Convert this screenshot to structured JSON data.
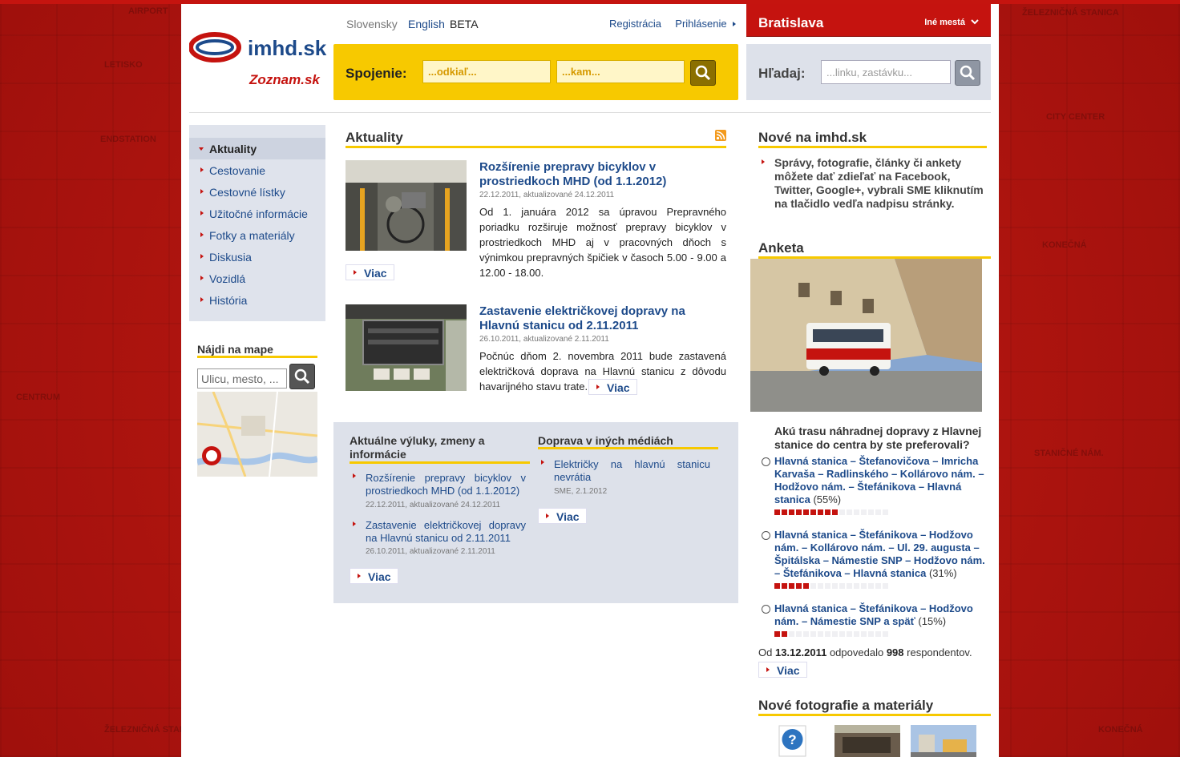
{
  "header": {
    "lang_slovak": "Slovensky",
    "lang_english": "English",
    "beta": "BETA",
    "register": "Registrácia",
    "login": "Prihlásenie",
    "city": "Bratislava",
    "other_cities": "Iné mestá",
    "logo_text": "imhd.sk",
    "logo_partner": "Zoznam.sk"
  },
  "connection": {
    "label": "Spojenie:",
    "from_placeholder": "...odkiaľ...",
    "to_placeholder": "...kam..."
  },
  "search": {
    "label": "Hľadaj:",
    "placeholder": "...linku, zastávku..."
  },
  "nav": {
    "items": [
      {
        "label": "Aktuality",
        "active": true
      },
      {
        "label": "Cestovanie"
      },
      {
        "label": "Cestovné lístky"
      },
      {
        "label": "Užitočné informácie"
      },
      {
        "label": "Fotky a materiály"
      },
      {
        "label": "Diskusia"
      },
      {
        "label": "Vozidlá"
      },
      {
        "label": "História"
      }
    ]
  },
  "map": {
    "title": "Nájdi na mape",
    "placeholder": "Ulicu, mesto, ..."
  },
  "news": {
    "title": "Aktuality",
    "items": [
      {
        "title": "Rozšírenie prepravy bicyklov v prostriedkoch MHD (od 1.1.2012)",
        "date": "22.12.2011, aktualizované 24.12.2011",
        "text": "Od 1. januára 2012 sa úpravou Prepravného poriadku rozširuje možnosť prepravy bicyklov v prostriedkoch MHD aj v pracovných dňoch s výnimkou prepravných špičiek v časoch 5.00 - 9.00 a 12.00 - 18.00.",
        "more": "Viac"
      },
      {
        "title": "Zastavenie električkovej dopravy na Hlavnú stanicu od 2.11.2011",
        "date": "26.10.2011, aktualizované 2.11.2011",
        "text": "Počnúc dňom 2. novembra 2011 bude zastavená električková doprava na Hlavnú stanicu z dôvodu havarijného stavu trate.",
        "more": "Viac"
      }
    ]
  },
  "outages": {
    "title": "Aktuálne výluky, zmeny a informácie",
    "items": [
      {
        "title": "Rozšírenie prepravy bicyklov v prostriedkoch MHD (od 1.1.2012)",
        "date": "22.12.2011, aktualizované 24.12.2011"
      },
      {
        "title": "Zastavenie električkovej dopravy na Hlavnú stanicu od 2.11.2011",
        "date": "26.10.2011, aktualizované 2.11.2011"
      }
    ],
    "more": "Viac"
  },
  "media": {
    "title": "Doprava v iných médiách",
    "items": [
      {
        "title": "Električky na hlavnú stanicu nevrátia",
        "date": "SME, 2.1.2012"
      }
    ],
    "more": "Viac"
  },
  "new_on_site": {
    "title": "Nové na imhd.sk",
    "text": "Správy, fotografie, články či ankety môžete dať zdieľať na Facebook, Twitter, Google+, vybrali SME kliknutím na tlačidlo vedľa nadpisu stránky."
  },
  "poll": {
    "title": "Anketa",
    "question": "Akú trasu náhradnej dopravy z Hlavnej stanice do centra by ste preferovali?",
    "options": [
      {
        "label": "Hlavná stanica – Štefanovičova – Imricha Karvaša – Radlinského – Kollárovo nám. – Hodžovo nám. – Štefánikova – Hlavná stanica",
        "pct": "(55%)",
        "value": 55
      },
      {
        "label": "Hlavná stanica – Štefánikova – Hodžovo nám. – Kollárovo nám. – Ul. 29. augusta – Špitálska – Námestie SNP – Hodžovo nám. – Štefánikova – Hlavná stanica",
        "pct": "(31%)",
        "value": 31
      },
      {
        "label": "Hlavná stanica – Štefánikova – Hodžovo nám. – Námestie SNP a späť",
        "pct": "(15%)",
        "value": 15
      }
    ],
    "resp_prefix": "Od",
    "resp_date": "13.12.2011",
    "resp_mid": "odpovedalo",
    "resp_count": "998",
    "resp_suffix": "respondentov.",
    "more": "Viac"
  },
  "photos": {
    "title": "Nové fotografie a materiály"
  },
  "colors": {
    "brand_red": "#c5130f",
    "accent_yellow": "#f7c900",
    "link_blue": "#1d4a8a",
    "panel_gray": "#dde1ea"
  }
}
